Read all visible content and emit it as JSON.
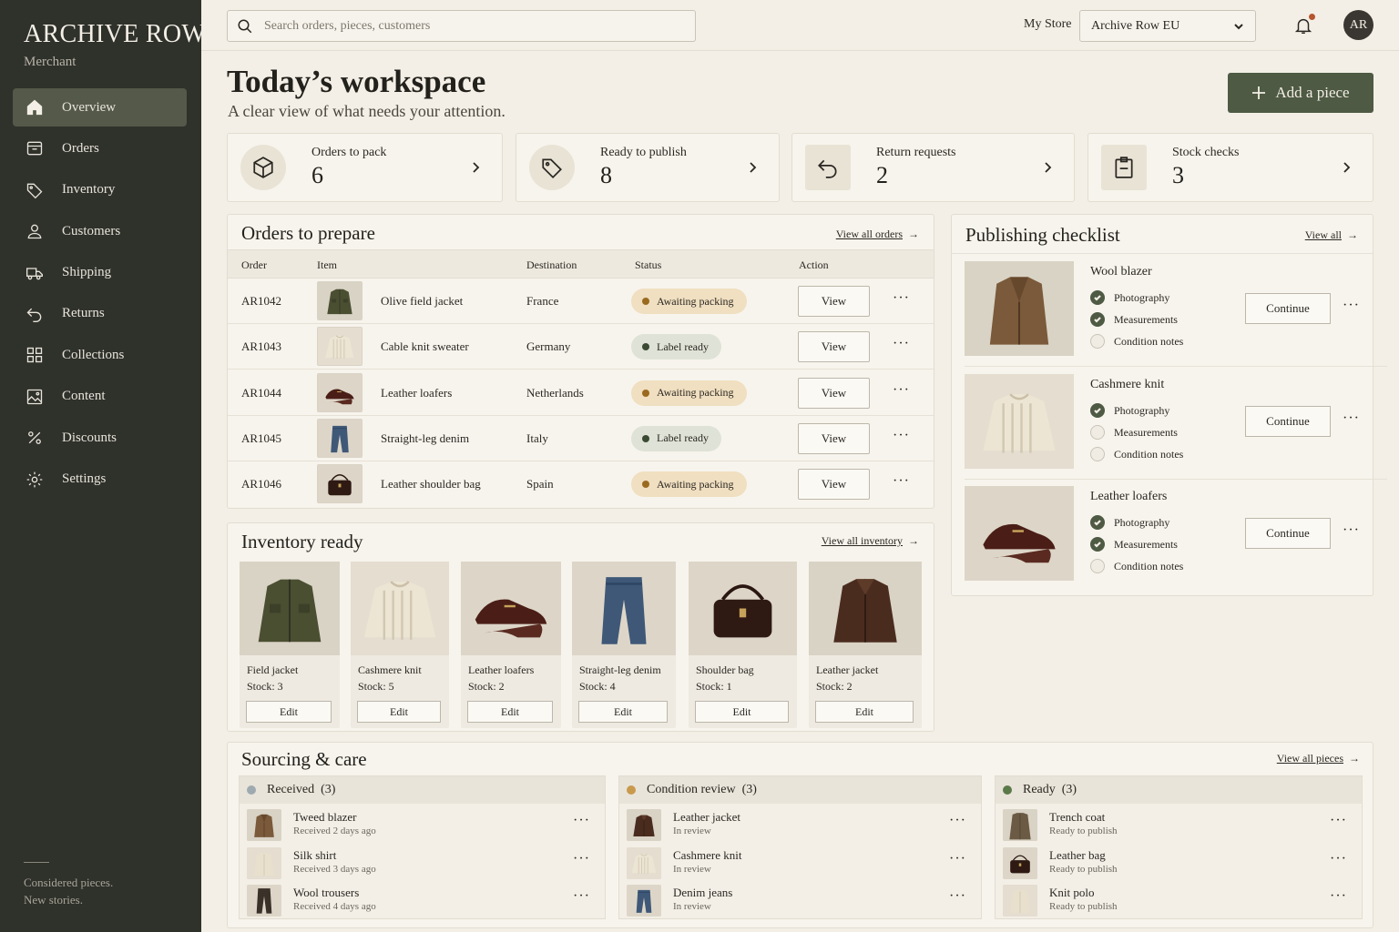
{
  "sidebar": {
    "brand": "ARCHIVE ROW",
    "brand_sub": "Merchant",
    "items": [
      {
        "label": "Overview",
        "icon": "home-icon"
      },
      {
        "label": "Orders",
        "icon": "box-icon"
      },
      {
        "label": "Inventory",
        "icon": "tag-icon"
      },
      {
        "label": "Customers",
        "icon": "user-icon"
      },
      {
        "label": "Shipping",
        "icon": "truck-icon"
      },
      {
        "label": "Returns",
        "icon": "return-icon"
      },
      {
        "label": "Collections",
        "icon": "grid-icon"
      },
      {
        "label": "Content",
        "icon": "image-icon"
      },
      {
        "label": "Discounts",
        "icon": "percent-icon"
      },
      {
        "label": "Settings",
        "icon": "gear-icon"
      }
    ],
    "footer": [
      "Considered pieces.",
      "New stories."
    ]
  },
  "topbar": {
    "search_placeholder": "Search orders, pieces, customers",
    "store_label": "My Store",
    "store_value": "Archive Row EU",
    "avatar": "AR"
  },
  "header": {
    "title": "Today’s workspace",
    "subtitle": "A clear view of what needs your attention.",
    "add_button": "Add a piece"
  },
  "stats": [
    {
      "label": "Orders to pack",
      "value": "6",
      "icon": "cube-icon"
    },
    {
      "label": "Ready to publish",
      "value": "8",
      "icon": "tag-icon"
    },
    {
      "label": "Return requests",
      "value": "2",
      "icon": "return-icon"
    },
    {
      "label": "Stock checks",
      "value": "3",
      "icon": "clipboard-icon"
    }
  ],
  "orders": {
    "title": "Orders to prepare",
    "link": "View all orders",
    "columns": [
      "Order",
      "Item",
      "Destination",
      "Status",
      "Action"
    ],
    "view_label": "View",
    "rows": [
      {
        "order": "AR1042",
        "item": "Olive field jacket",
        "destination": "France",
        "status": "Awaiting packing",
        "kind": "await",
        "thumb": "jacket"
      },
      {
        "order": "AR1043",
        "item": "Cable knit sweater",
        "destination": "Germany",
        "status": "Label ready",
        "kind": "label",
        "thumb": "sweater"
      },
      {
        "order": "AR1044",
        "item": "Leather loafers",
        "destination": "Netherlands",
        "status": "Awaiting packing",
        "kind": "await",
        "thumb": "loafer"
      },
      {
        "order": "AR1045",
        "item": "Straight-leg denim",
        "destination": "Italy",
        "status": "Label ready",
        "kind": "label",
        "thumb": "denim"
      },
      {
        "order": "AR1046",
        "item": "Leather shoulder bag",
        "destination": "Spain",
        "status": "Awaiting packing",
        "kind": "await",
        "thumb": "bag"
      }
    ]
  },
  "inventory": {
    "title": "Inventory ready",
    "link": "View all inventory",
    "edit_label": "Edit",
    "items": [
      {
        "name": "Field jacket",
        "stock": "Stock: 3",
        "thumb": "jacket"
      },
      {
        "name": "Cashmere knit",
        "stock": "Stock: 5",
        "thumb": "sweater"
      },
      {
        "name": "Leather loafers",
        "stock": "Stock: 2",
        "thumb": "loafer"
      },
      {
        "name": "Straight-leg denim",
        "stock": "Stock: 4",
        "thumb": "denim"
      },
      {
        "name": "Shoulder bag",
        "stock": "Stock: 1",
        "thumb": "bag"
      },
      {
        "name": "Leather jacket",
        "stock": "Stock: 2",
        "thumb": "leather"
      }
    ]
  },
  "checklist": {
    "title": "Publishing checklist",
    "link": "View all",
    "continue_label": "Continue",
    "items": [
      {
        "name": "Wool blazer",
        "thumb": "blazer",
        "steps": [
          {
            "label": "Photography",
            "done": true
          },
          {
            "label": "Measurements",
            "done": true
          },
          {
            "label": "Condition notes",
            "done": false
          }
        ]
      },
      {
        "name": "Cashmere knit",
        "thumb": "sweater",
        "steps": [
          {
            "label": "Photography",
            "done": true
          },
          {
            "label": "Measurements",
            "done": false
          },
          {
            "label": "Condition notes",
            "done": false
          }
        ]
      },
      {
        "name": "Leather loafers",
        "thumb": "loafer",
        "steps": [
          {
            "label": "Photography",
            "done": true
          },
          {
            "label": "Measurements",
            "done": true
          },
          {
            "label": "Condition notes",
            "done": false
          }
        ]
      }
    ]
  },
  "sourcing": {
    "title": "Sourcing & care",
    "link": "View all pieces",
    "columns": [
      {
        "label": "Received",
        "count": "(3)",
        "color": "#9eaab0",
        "items": [
          {
            "name": "Tweed blazer",
            "sub": "Received 2 days ago",
            "thumb": "blazer"
          },
          {
            "name": "Silk shirt",
            "sub": "Received 3 days ago",
            "thumb": "shirt"
          },
          {
            "name": "Wool trousers",
            "sub": "Received 4 days ago",
            "thumb": "trousers"
          }
        ]
      },
      {
        "label": "Condition review",
        "count": "(3)",
        "color": "#c99a4e",
        "items": [
          {
            "name": "Leather jacket",
            "sub": "In review",
            "thumb": "leather"
          },
          {
            "name": "Cashmere knit",
            "sub": "In review",
            "thumb": "sweater"
          },
          {
            "name": "Denim jeans",
            "sub": "In review",
            "thumb": "denim"
          }
        ]
      },
      {
        "label": "Ready",
        "count": "(3)",
        "color": "#5b7a4a",
        "items": [
          {
            "name": "Trench coat",
            "sub": "Ready to publish",
            "thumb": "trench"
          },
          {
            "name": "Leather bag",
            "sub": "Ready to publish",
            "thumb": "bag"
          },
          {
            "name": "Knit polo",
            "sub": "Ready to publish",
            "thumb": "shirt"
          }
        ]
      }
    ]
  }
}
